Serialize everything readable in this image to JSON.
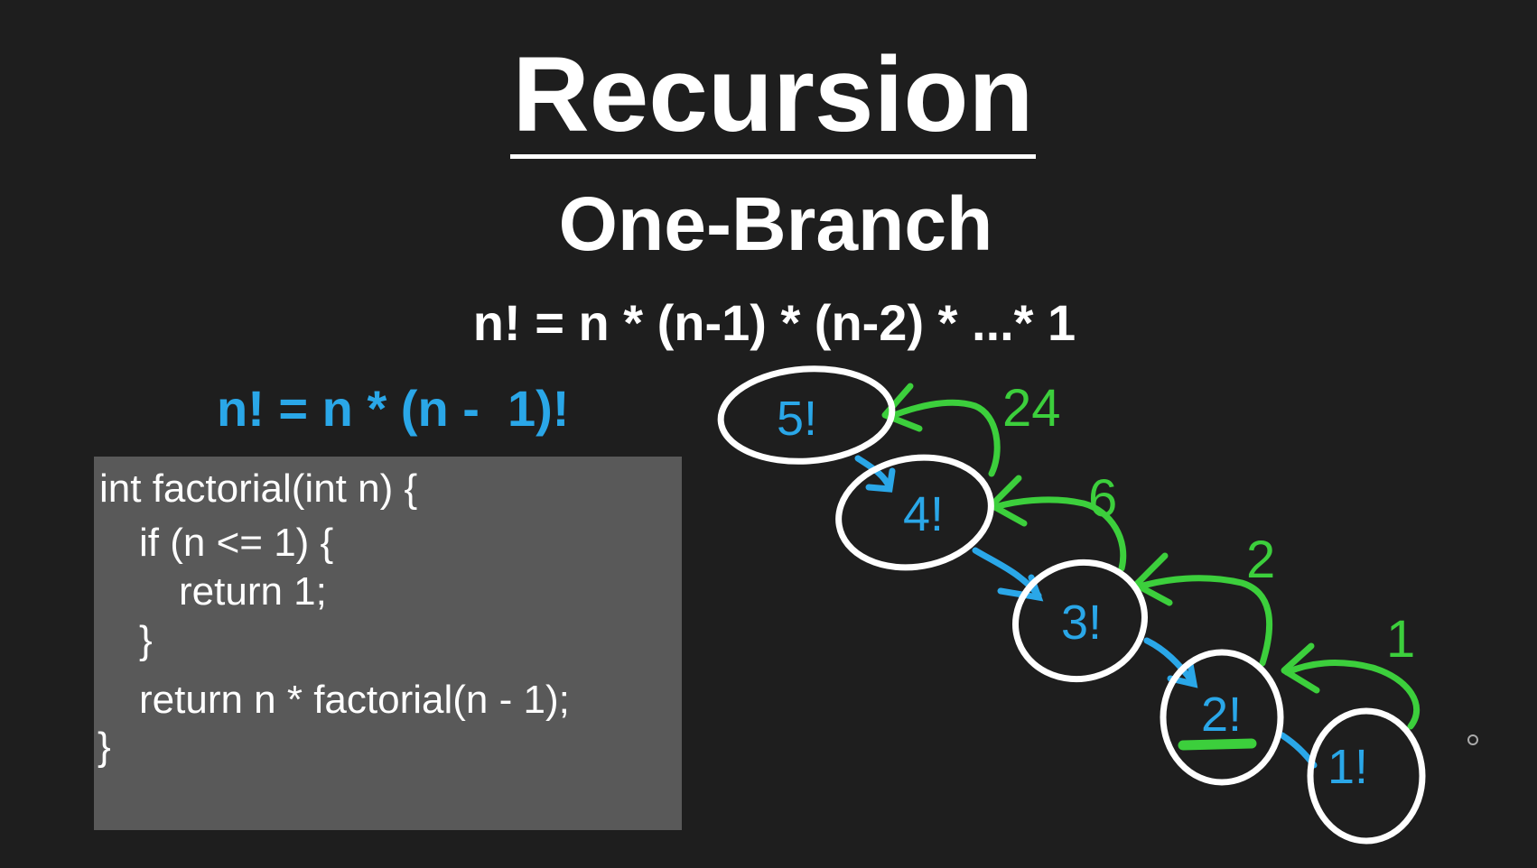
{
  "title": "Recursion",
  "subtitle": "One-Branch",
  "formula": "n! = n * (n-1) * (n-2) * ...* 1",
  "recurrence": "n! = n * (n -  1)!",
  "code": {
    "lines": [
      "int factorial(int n) {",
      "if (n <= 1) {",
      "return 1;",
      "}",
      "return n * factorial(n - 1);",
      "}"
    ]
  },
  "call_nodes": [
    "5!",
    "4!",
    "3!",
    "2!",
    "1!"
  ],
  "return_values": [
    "24",
    "6",
    "2",
    "1"
  ],
  "colors": {
    "background": "#1e1e1e",
    "call_arrow": "#2aa7e8",
    "return_arrow": "#3ccf3c",
    "node_outline": "#ffffff",
    "code_background": "#595959"
  }
}
